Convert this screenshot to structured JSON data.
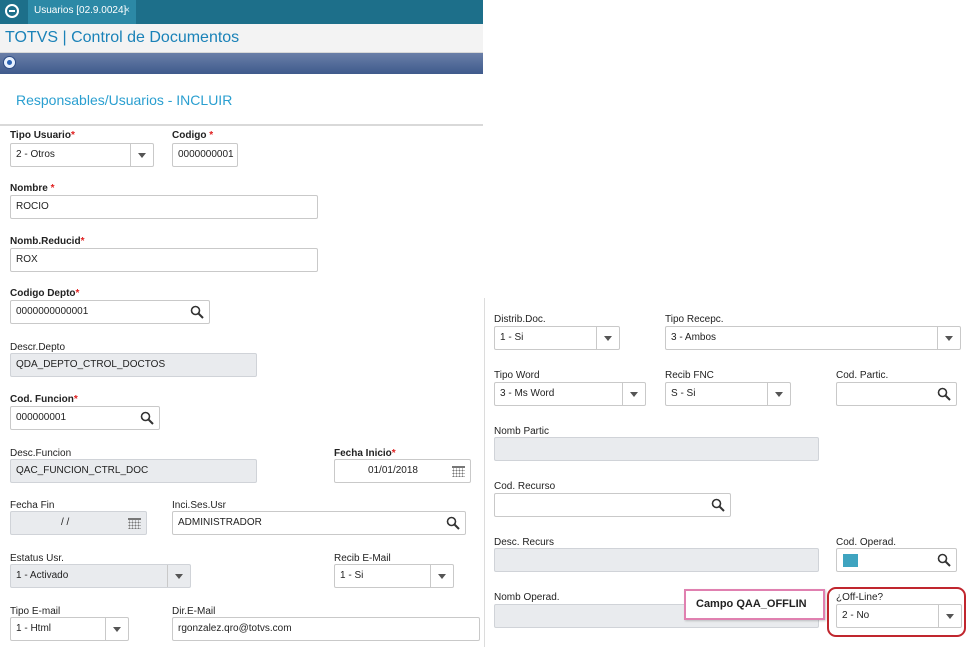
{
  "tabbar": {
    "tab_label": "Usuarios [02.9.0024]",
    "close_glyph": "×"
  },
  "app": {
    "title": "TOTVS | Control de Documentos"
  },
  "form": {
    "title": "Responsables/Usuarios - INCLUIR"
  },
  "left": {
    "tipo_usuario": {
      "label": "Tipo Usuario",
      "value": "2 - Otros"
    },
    "codigo": {
      "label": "Codigo",
      "value": "0000000001"
    },
    "nombre": {
      "label": "Nombre",
      "value": "ROCIO"
    },
    "nomb_reducid": {
      "label": "Nomb.Reducid",
      "value": "ROX"
    },
    "codigo_depto": {
      "label": "Codigo Depto",
      "value": "0000000000001"
    },
    "descr_depto": {
      "label": "Descr.Depto",
      "value": "QDA_DEPTO_CTROL_DOCTOS"
    },
    "cod_funcion": {
      "label": "Cod. Funcion",
      "value": "000000001"
    },
    "desc_funcion": {
      "label": "Desc.Funcion",
      "value": "QAC_FUNCION_CTRL_DOC"
    },
    "fecha_inicio": {
      "label": "Fecha Inicio",
      "value": "01/01/2018"
    },
    "fecha_fin": {
      "label": "Fecha Fin",
      "value": "/ /"
    },
    "inci_ses_usr": {
      "label": "Inci.Ses.Usr",
      "value": "ADMINISTRADOR"
    },
    "estatus_usr": {
      "label": "Estatus Usr.",
      "value": "1 - Activado"
    },
    "recib_email": {
      "label": "Recib E-Mail",
      "value": "1 - Si"
    },
    "tipo_email": {
      "label": "Tipo E-mail",
      "value": "1 - Html"
    },
    "dir_email": {
      "label": "Dir.E-Mail",
      "value": "rgonzalez.qro@totvs.com"
    }
  },
  "right": {
    "distrib_doc": {
      "label": "Distrib.Doc.",
      "value": "1 - Si"
    },
    "tipo_recepc": {
      "label": "Tipo Recepc.",
      "value": "3 - Ambos"
    },
    "tipo_word": {
      "label": "Tipo Word",
      "value": "3 - Ms Word"
    },
    "recib_fnc": {
      "label": "Recib FNC",
      "value": "S - Si"
    },
    "cod_partic": {
      "label": "Cod. Partic.",
      "value": ""
    },
    "nomb_partic": {
      "label": "Nomb  Partic",
      "value": ""
    },
    "cod_recurso": {
      "label": "Cod. Recurso",
      "value": ""
    },
    "desc_recurs": {
      "label": "Desc. Recurs",
      "value": ""
    },
    "cod_operad": {
      "label": "Cod. Operad.",
      "value": ""
    },
    "nomb_operad": {
      "label": "Nomb Operad.",
      "value": ""
    },
    "off_line": {
      "label": "¿Off-Line?",
      "value": "2 - No"
    }
  },
  "callout": {
    "text": "Campo QAA_OFFLIN"
  },
  "required_mark": "*",
  "colors": {
    "brand_bar": "#1d6f8a",
    "title_blue": "#1a82b8",
    "form_title": "#2a9fd0",
    "required": "#e02020",
    "highlight": "#c0262e",
    "callout_border": "#e080b0"
  },
  "icons": [
    "totvs-logo-icon",
    "close-icon",
    "nav-home-icon",
    "search-icon",
    "calendar-icon",
    "chevron-down-icon"
  ]
}
